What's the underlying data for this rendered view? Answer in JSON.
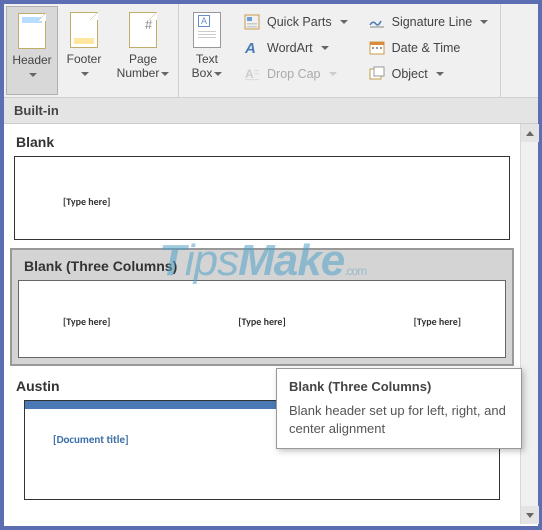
{
  "ribbon": {
    "header": "Header",
    "footer": "Footer",
    "page_number": "Page\nNumber",
    "text_box": "Text\nBox",
    "quick_parts": "Quick Parts",
    "wordart": "WordArt",
    "drop_cap": "Drop Cap",
    "signature": "Signature Line",
    "datetime": "Date & Time",
    "object": "Object"
  },
  "gallery": {
    "header": "Built-in",
    "items": [
      {
        "title": "Blank",
        "placeholder": "[Type here]"
      },
      {
        "title": "Blank (Three Columns)",
        "p1": "[Type here]",
        "p2": "[Type here]",
        "p3": "[Type here]"
      },
      {
        "title": "Austin",
        "placeholder": "[Document title]"
      }
    ]
  },
  "tooltip": {
    "title": "Blank (Three Columns)",
    "desc": "Blank header set up for left, right, and center alignment"
  },
  "watermark": {
    "t1": "T",
    "t2": "ips",
    "t3": "Make",
    "t4": ".com"
  }
}
